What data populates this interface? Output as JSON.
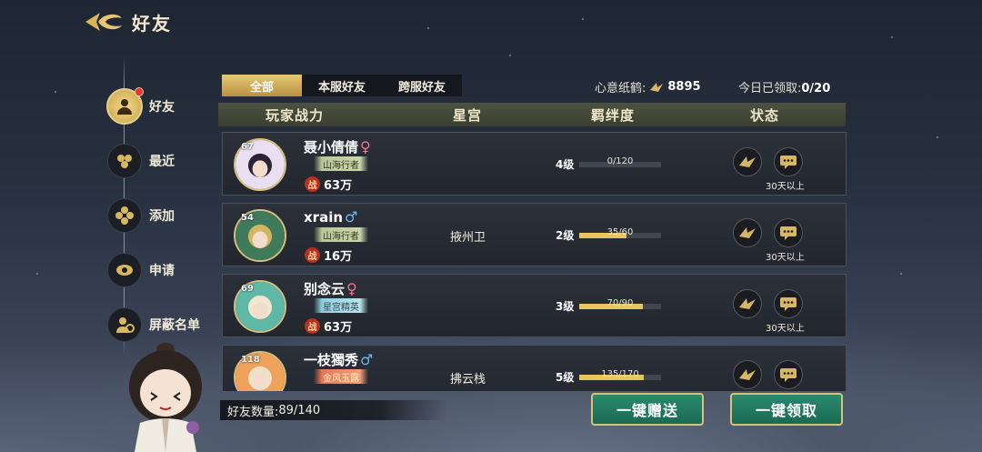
{
  "header": {
    "title": "好友"
  },
  "sidebar": {
    "items": [
      {
        "label": "好友",
        "active": true,
        "icon": "friends-icon"
      },
      {
        "label": "最近",
        "icon": "recent-icon"
      },
      {
        "label": "添加",
        "icon": "add-friend-icon"
      },
      {
        "label": "申请",
        "icon": "request-icon"
      },
      {
        "label": "屏蔽名单",
        "icon": "blocklist-icon"
      }
    ]
  },
  "tabs": [
    {
      "label": "全部",
      "selected": true
    },
    {
      "label": "本服好友"
    },
    {
      "label": "跨服好友"
    }
  ],
  "currency": {
    "label": "心意纸鹤:",
    "value": "8895",
    "icon": "paper-crane-icon"
  },
  "daily": {
    "label": "今日已领取:",
    "value": "0/20"
  },
  "columns": {
    "power": "玩家战力",
    "star": "星宫",
    "bond": "羁绊度",
    "status": "状态"
  },
  "friends": [
    {
      "level": "67",
      "name": "聂小倩倩",
      "sex": "♀",
      "sex_class": "f",
      "title": "山海行者",
      "title_style": "",
      "power": "63万",
      "star": "",
      "bond_level": "4级",
      "bond_text": "0/120",
      "bond_fill": 0.0,
      "status": "30天以上"
    },
    {
      "level": "54",
      "name": "xrain",
      "sex": "♂",
      "sex_class": "m",
      "title": "山海行者",
      "title_style": "",
      "power": "16万",
      "star": "掖州卫",
      "bond_level": "2级",
      "bond_text": "35/60",
      "bond_fill": 0.58,
      "status": "30天以上"
    },
    {
      "level": "69",
      "name": "别念云",
      "sex": "♀",
      "sex_class": "f",
      "title": "星宫精英",
      "title_style": "blue",
      "power": "63万",
      "star": "",
      "bond_level": "3级",
      "bond_text": "70/90",
      "bond_fill": 0.78,
      "status": "30天以上"
    },
    {
      "level": "118",
      "name": "一枝獨秀",
      "sex": "♂",
      "sex_class": "m",
      "title": "金风玉露",
      "title_style": "red",
      "power": "",
      "star": "拂云栈",
      "bond_level": "5级",
      "bond_text": "135/170",
      "bond_fill": 0.79,
      "status": ""
    }
  ],
  "power_badge": "战",
  "footer": {
    "count_label": "好友数量:",
    "count_value": "89/140",
    "gift_all": "一键赠送",
    "claim_all": "一键领取"
  },
  "colors": {
    "accent": "#d8c27a",
    "button_green": "#1f7a5f",
    "bond_fill": "#e7c65b"
  }
}
